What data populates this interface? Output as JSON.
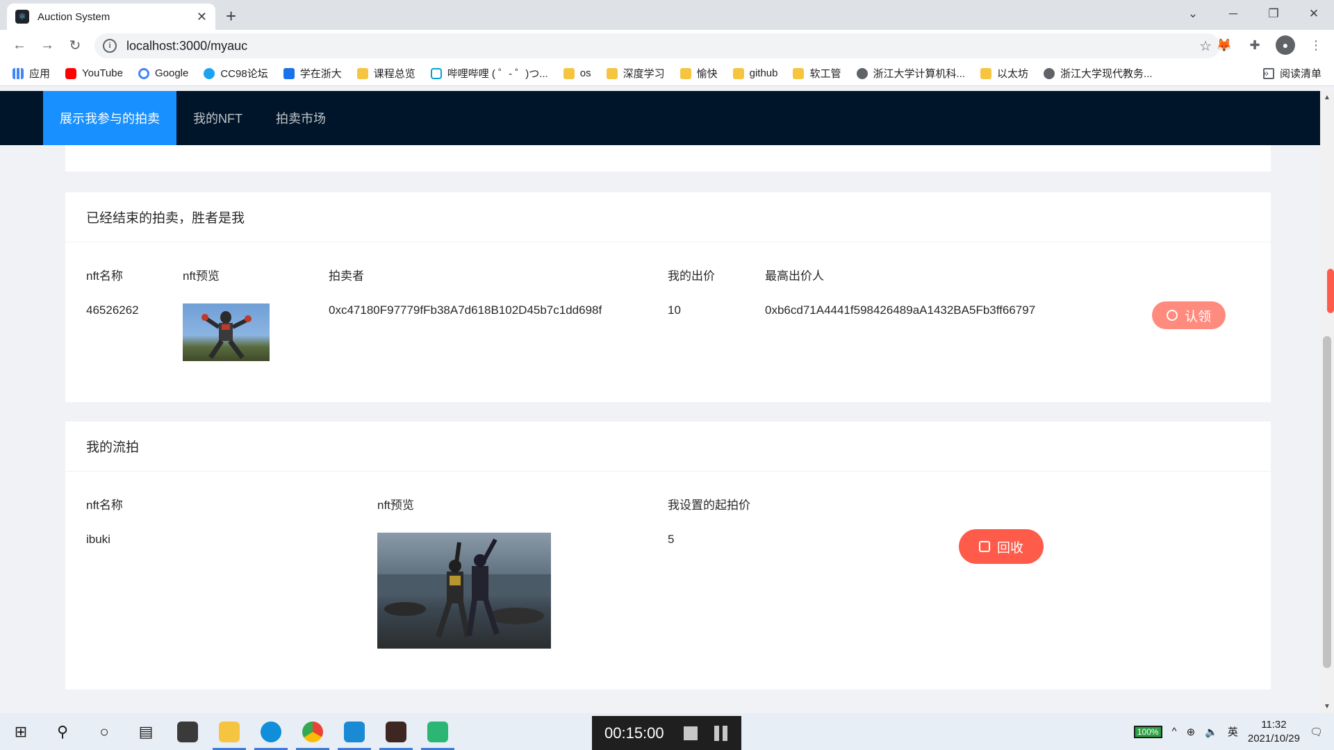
{
  "browser": {
    "tab_title": "Auction System",
    "url": "localhost:3000/myauc",
    "bookmarks": [
      "应用",
      "YouTube",
      "Google",
      "CC98论坛",
      "学在浙大",
      "课程总览",
      "哔哩哔哩 ( ゜- ゜)つ...",
      "os",
      "深度学习",
      "愉快",
      "github",
      "软工管",
      "浙江大学计算机科...",
      "以太坊",
      "浙江大学现代教务..."
    ],
    "more": "»",
    "reading_list": "阅读清单"
  },
  "nav": {
    "items": [
      "展示我参与的拍卖",
      "我的NFT",
      "拍卖市场"
    ],
    "active": 0
  },
  "won_card": {
    "title": "已经结束的拍卖，胜者是我",
    "headers": [
      "nft名称",
      "nft预览",
      "拍卖者",
      "我的出价",
      "最高出价人"
    ],
    "row": {
      "name": "46526262",
      "auctioneer": "0xc47180F97779fFb38A7d618B102D45b7c1dd698f",
      "my_bid": "10",
      "highest_bidder": "0xb6cd71A4441f598426489aA1432BA5Fb3ff66797"
    },
    "action": "认领"
  },
  "failed_card": {
    "title": "我的流拍",
    "headers": [
      "nft名称",
      "nft预览",
      "我设置的起拍价"
    ],
    "row": {
      "name": "ibuki",
      "start_price": "5"
    },
    "action": "回收"
  },
  "taskbar": {
    "timer": "00:15:00",
    "battery": "100%",
    "ime": "英",
    "time": "11:32",
    "date": "2021/10/29"
  }
}
